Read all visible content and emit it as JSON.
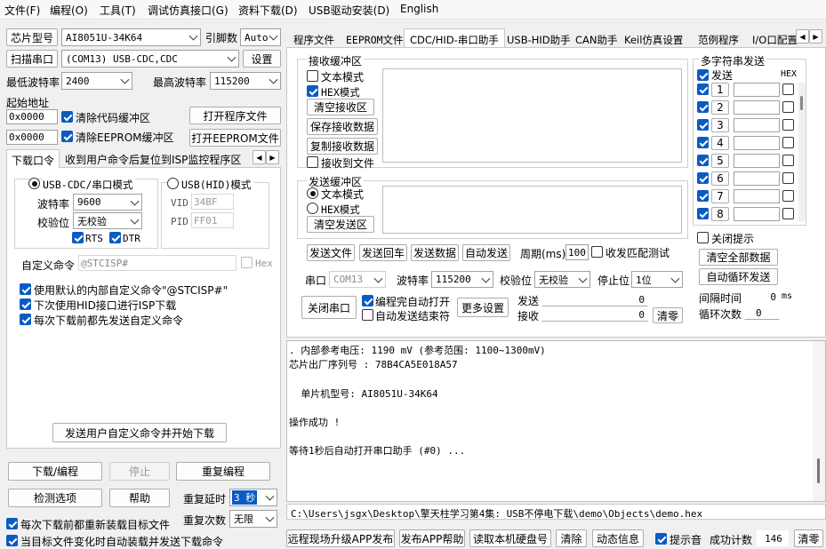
{
  "menu": [
    "文件(F)",
    "编程(O)",
    "工具(T)",
    "调试仿真接口(G)",
    "资料下载(D)",
    "USB驱动安装(D)",
    "English"
  ],
  "left": {
    "chip_label": "芯片型号",
    "chip_value": "AI8051U-34K64",
    "pin_label": "引脚数",
    "pin_value": "Auto",
    "scan_label": "扫描串口",
    "port_value": "(COM13) USB-CDC,CDC",
    "settings_label": "设置",
    "min_baud_label": "最低波特率",
    "min_baud_value": "2400",
    "max_baud_label": "最高波特率",
    "max_baud_value": "115200",
    "start_addr_label": "起始地址",
    "addr1": "0x0000",
    "clear_code_label": "清除代码缓冲区",
    "open_prog_label": "打开程序文件",
    "addr2": "0x0000",
    "clear_eeprom_label": "清除EEPROM缓冲区",
    "open_eeprom_label": "打开EEPROM文件",
    "tabs": [
      "下载口令",
      "收到用户命令后复位到ISP监控程序区"
    ],
    "radio_cdc": "USB-CDC/串口模式",
    "radio_hid": "USB(HID)模式",
    "baud_label": "波特率",
    "baud_value": "9600",
    "parity_label": "校验位",
    "parity_value": "无校验",
    "rts": "RTS",
    "dtr": "DTR",
    "vid_label": "VID",
    "vid_value": "34BF",
    "pid_label": "PID",
    "pid_value": "FF01",
    "custom_cmd_label": "自定义命令",
    "custom_cmd_value": "@STCISP#",
    "hex_label": "Hex",
    "opt1": "使用默认的内部自定义命令\"@STCISP#\"",
    "opt2": "下次使用HID接口进行ISP下载",
    "opt3": "每次下载前都先发送自定义命令",
    "send_cmd_btn": "发送用户自定义命令并开始下载",
    "download_btn": "下载/编程",
    "stop_btn": "停止",
    "reprog_btn": "重复编程",
    "check_btn": "检测选项",
    "help_btn": "帮助",
    "delay_label": "重复延时",
    "delay_value": "3 秒",
    "count_label": "重复次数",
    "count_value": "无限",
    "reload_label": "每次下载前都重新装载目标文件",
    "auto_label": "当目标文件变化时自动装载并发送下载命令"
  },
  "right": {
    "tabs": [
      "程序文件",
      "EEPROM文件",
      "CDC/HID-串口助手",
      "USB-HID助手",
      "CAN助手",
      "Keil仿真设置",
      "范例程序",
      "I/O口配置"
    ],
    "recv_title": "接收缓冲区",
    "text_mode": "文本模式",
    "hex_mode": "HEX模式",
    "clear_recv": "清空接收区",
    "save_recv": "保存接收数据",
    "copy_recv": "复制接收数据",
    "recv_to_file": "接收到文件",
    "send_title": "发送缓冲区",
    "clear_send": "清空发送区",
    "multi_title": "多字符串发送",
    "send_label": "发送",
    "hex_col": "HEX",
    "multi_rows": [
      "1",
      "2",
      "3",
      "4",
      "5",
      "6",
      "7",
      "8"
    ],
    "close_prompt": "关闭提示",
    "clear_all": "清空全部数据",
    "auto_loop": "自动循环发送",
    "interval_label": "间隔时间",
    "interval_value": "0",
    "interval_unit": "ms",
    "loop_label": "循环次数",
    "loop_value": "0",
    "send_file": "发送文件",
    "send_back": "发送回车",
    "send_data": "发送数据",
    "auto_send": "自动发送",
    "period_label": "周期(ms)",
    "period_value": "100",
    "match_label": "收发匹配测试",
    "port_label": "串口",
    "port_value": "COM13",
    "baud_label": "波特率",
    "baud_value": "115200",
    "parity_label": "校验位",
    "parity_value": "无校验",
    "stop_label": "停止位",
    "stop_value": "1位",
    "close_port": "关闭串口",
    "auto_open": "编程完自动打开",
    "auto_end": "自动发送结束符",
    "more_settings": "更多设置",
    "sent_label": "发送",
    "sent_value": "0",
    "recv_label": "接收",
    "recv_value": "0",
    "clear_counts": "清零"
  },
  "log": {
    "lines": [
      ". 内部参考电压: 1190 mV (参考范围: 1100~1300mV)",
      "芯片出厂序列号 : 78B4CA5E018A57",
      "",
      "  单片机型号: AI8051U-34K64",
      "",
      "操作成功 !",
      "",
      "等待1秒后自动打开串口助手 (#0) ..."
    ],
    "path": "C:\\Users\\jsgx\\Desktop\\擎天柱学习第4集: USB不停电下载\\demo\\Objects\\demo.hex"
  },
  "bottom": {
    "upgrade": "远程现场升级APP发布",
    "app_help": "发布APP帮助",
    "read_disk": "读取本机硬盘号",
    "clear": "清除",
    "dynamic": "动态信息",
    "sound": "提示音",
    "success_label": "成功计数",
    "success_value": "146",
    "reset": "清零"
  }
}
